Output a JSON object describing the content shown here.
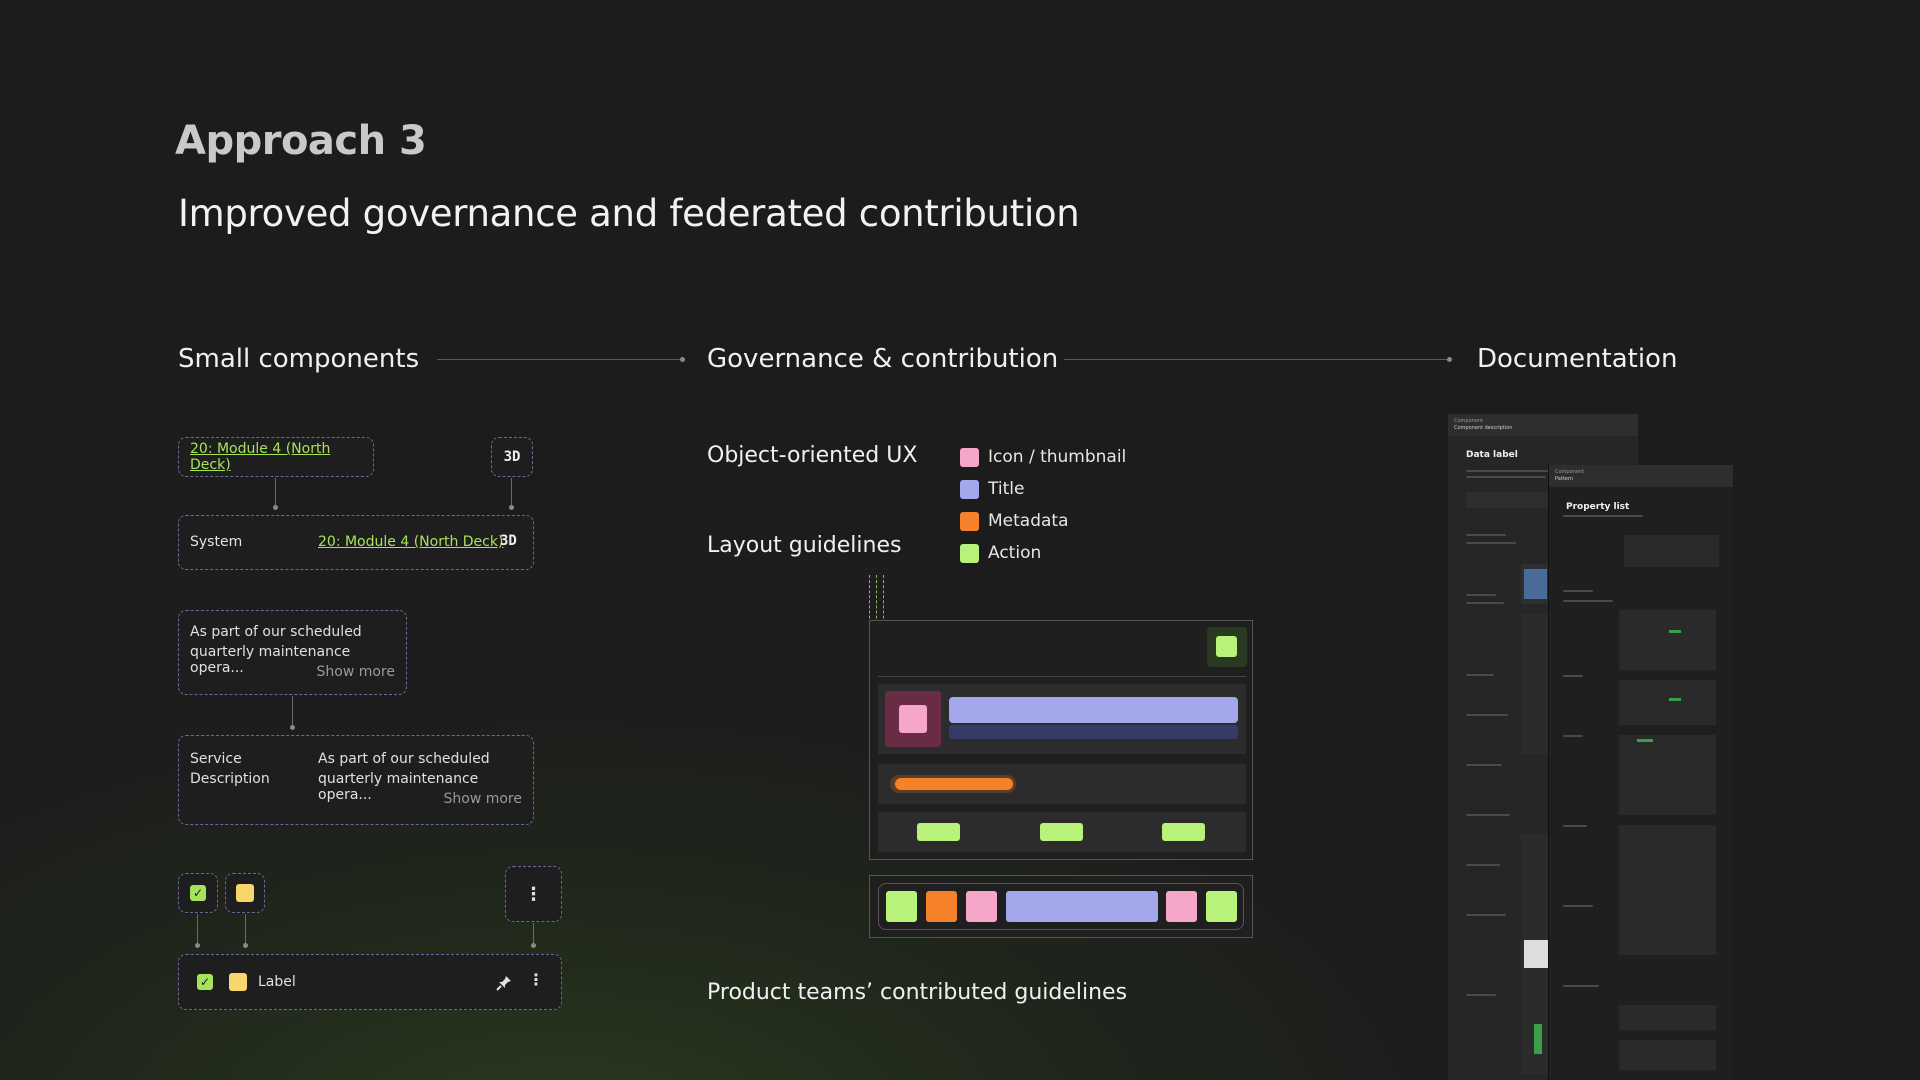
{
  "header": {
    "approach": "Approach 3",
    "subtitle": "Improved governance and federated contribution"
  },
  "sections": {
    "small": "Small components",
    "governance": "Governance & contribution",
    "documentation": "Documentation"
  },
  "components": {
    "chip_link": "20: Module 4 (North Deck)",
    "badge_3d": "3D",
    "system_label": "System",
    "system_link": "20: Module 4 (North Deck)",
    "description_text_1": "As part of our scheduled",
    "description_text_2": "quarterly maintenance opera...",
    "show_more": "Show more",
    "service_label_1": "Service",
    "service_label_2": "Description",
    "label_row": "Label",
    "more_icon": "⋮"
  },
  "governance": {
    "object_ux": "Object-oriented UX",
    "layout": "Layout guidelines",
    "contributed": "Product teams’ contributed guidelines",
    "legend": [
      {
        "label": "Icon / thumbnail",
        "color": "#f5a6c9"
      },
      {
        "label": "Title",
        "color": "#a3a8ec"
      },
      {
        "label": "Metadata",
        "color": "#f5822b"
      },
      {
        "label": "Action",
        "color": "#b8f27a"
      }
    ]
  },
  "documentation": {
    "panel1_kicker": "Component",
    "panel1_sub": "Component description",
    "panel1_title": "Data label",
    "panel2_kicker": "Component",
    "panel2_sub": "Pattern",
    "panel2_title": "Property list"
  },
  "colors": {
    "pink": "#f5a6c9",
    "lavender": "#a3a8ec",
    "orange": "#f5822b",
    "green": "#b8f27a",
    "yellow": "#f7d66b"
  }
}
